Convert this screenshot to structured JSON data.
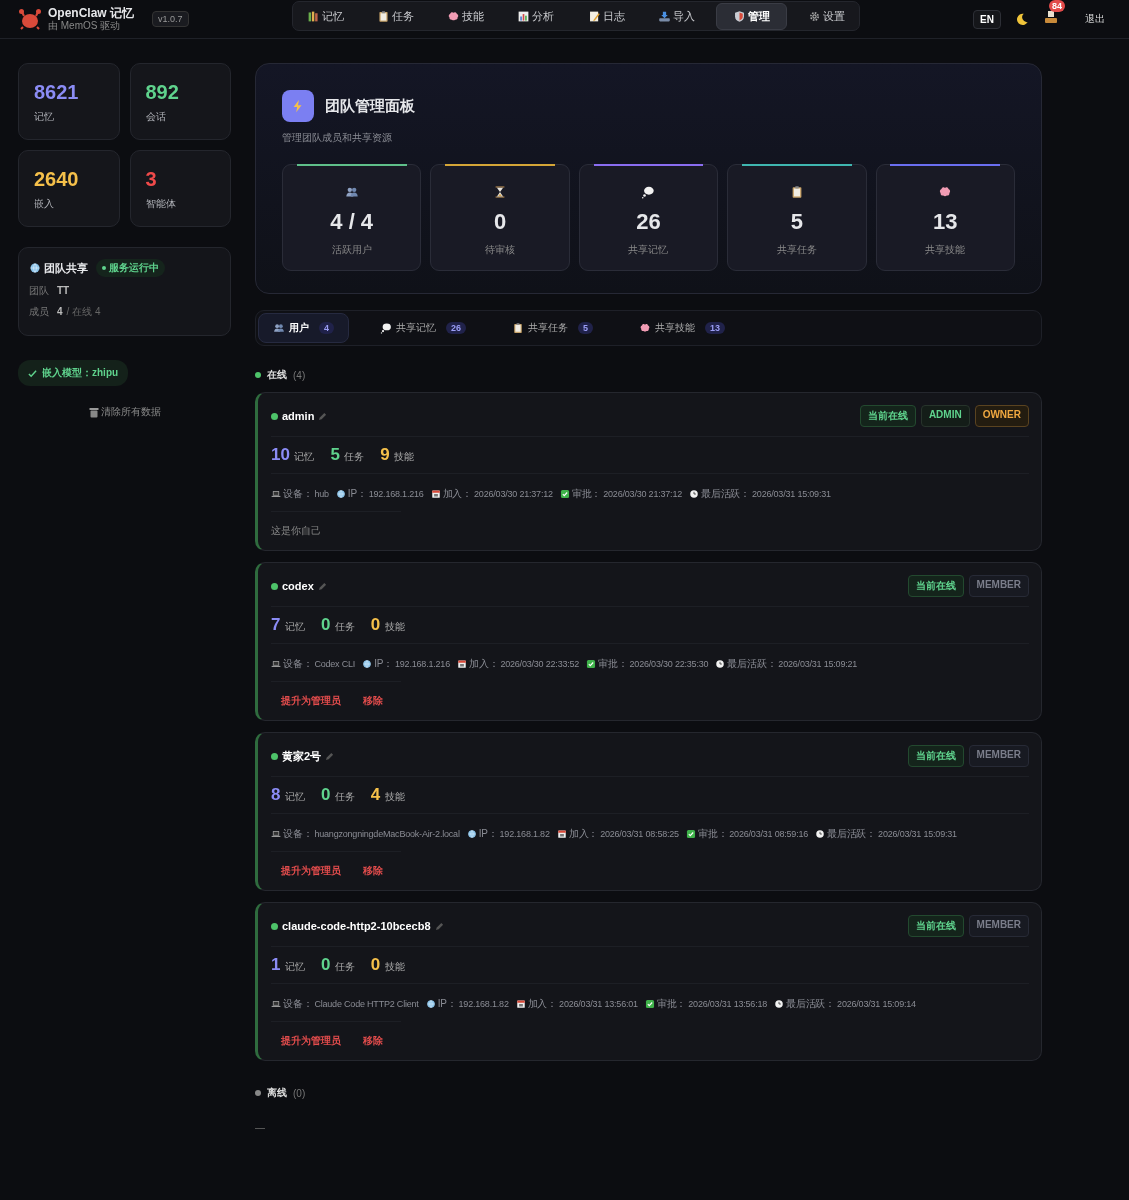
{
  "header": {
    "app_name": "OpenClaw 记忆",
    "subtitle": "由 MemOS 驱动",
    "version": "v1.0.7",
    "nav": [
      {
        "label": "记忆",
        "selected": false
      },
      {
        "label": "任务",
        "selected": false
      },
      {
        "label": "技能",
        "selected": false
      },
      {
        "label": "分析",
        "selected": false
      },
      {
        "label": "日志",
        "selected": false
      },
      {
        "label": "导入",
        "selected": false
      },
      {
        "label": "管理",
        "selected": true
      },
      {
        "label": "设置",
        "selected": false
      }
    ],
    "language": "EN",
    "notification_count": "84",
    "logout": "退出"
  },
  "sidebar": {
    "stats": [
      {
        "value": "8621",
        "label": "记忆",
        "color": "#8b8cf5"
      },
      {
        "value": "892",
        "label": "会话",
        "color": "#5fd38d"
      },
      {
        "value": "2640",
        "label": "嵌入",
        "color": "#f5c04a"
      },
      {
        "value": "3",
        "label": "智能体",
        "color": "#ef4a4a"
      }
    ],
    "team_share": {
      "title": "团队共享",
      "status": "服务运行中",
      "running": true,
      "team_label": "团队",
      "team_value": "TT",
      "members_label": "成员",
      "members_value": "4",
      "members_online": "/ 在线 4"
    },
    "embedding": "嵌入模型：zhipu",
    "clear_data": "清除所有数据"
  },
  "panel": {
    "title": "团队管理面板",
    "subtitle": "管理团队成员和共享资源",
    "stats": [
      {
        "value": "4 / 4",
        "label": "活跃用户",
        "color": "#5fbf8a"
      },
      {
        "value": "0",
        "label": "待审核",
        "color": "#d4a537"
      },
      {
        "value": "26",
        "label": "共享记忆",
        "color": "#8a6df0"
      },
      {
        "value": "5",
        "label": "共享任务",
        "color": "#3fb6b0"
      },
      {
        "value": "13",
        "label": "共享技能",
        "color": "#6a6ef0"
      }
    ]
  },
  "tabs": [
    {
      "label": "用户",
      "count": "4",
      "selected": true
    },
    {
      "label": "共享记忆",
      "count": "26",
      "selected": false
    },
    {
      "label": "共享任务",
      "count": "5",
      "selected": false
    },
    {
      "label": "共享技能",
      "count": "13",
      "selected": false
    }
  ],
  "online_section": {
    "title": "在线",
    "count": "(4)"
  },
  "users": [
    {
      "name": "admin",
      "online": true,
      "badges": [
        {
          "label": "当前在线",
          "kind": "online"
        },
        {
          "label": "ADMIN",
          "kind": "admin"
        },
        {
          "label": "OWNER",
          "kind": "owner"
        }
      ],
      "counts": [
        {
          "amount": "10",
          "unit": "记忆"
        },
        {
          "amount": "5",
          "unit": "任务"
        },
        {
          "amount": "9",
          "unit": "技能"
        }
      ],
      "meta": [
        {
          "label": "设备：",
          "value": "hub"
        },
        {
          "label": "IP：",
          "value": "192.168.1.216"
        },
        {
          "label": "加入：",
          "value": "2026/03/30 21:37:12"
        },
        {
          "label": "审批：",
          "value": "2026/03/30 21:37:12"
        },
        {
          "label": "最后活跃：",
          "value": "2026/03/31 15:09:31"
        }
      ],
      "note": "这是你自己"
    },
    {
      "name": "codex",
      "online": true,
      "badges": [
        {
          "label": "当前在线",
          "kind": "online"
        },
        {
          "label": "MEMBER",
          "kind": "member"
        }
      ],
      "counts": [
        {
          "amount": "7",
          "unit": "记忆"
        },
        {
          "amount": "0",
          "unit": "任务"
        },
        {
          "amount": "0",
          "unit": "技能"
        }
      ],
      "meta": [
        {
          "label": "设备：",
          "value": "Codex CLI"
        },
        {
          "label": "IP：",
          "value": "192.168.1.216"
        },
        {
          "label": "加入：",
          "value": "2026/03/30 22:33:52"
        },
        {
          "label": "审批：",
          "value": "2026/03/30 22:35:30"
        },
        {
          "label": "最后活跃：",
          "value": "2026/03/31 15:09:21"
        }
      ],
      "actions": [
        "提升为管理员",
        "移除"
      ]
    },
    {
      "name": "黄家2号",
      "online": true,
      "badges": [
        {
          "label": "当前在线",
          "kind": "online"
        },
        {
          "label": "MEMBER",
          "kind": "member"
        }
      ],
      "counts": [
        {
          "amount": "8",
          "unit": "记忆"
        },
        {
          "amount": "0",
          "unit": "任务"
        },
        {
          "amount": "4",
          "unit": "技能"
        }
      ],
      "meta": [
        {
          "label": "设备：",
          "value": "huangzongningdeMacBook-Air-2.local"
        },
        {
          "label": "IP：",
          "value": "192.168.1.82"
        },
        {
          "label": "加入：",
          "value": "2026/03/31 08:58:25"
        },
        {
          "label": "审批：",
          "value": "2026/03/31 08:59:16"
        },
        {
          "label": "最后活跃：",
          "value": "2026/03/31 15:09:31"
        }
      ],
      "actions": [
        "提升为管理员",
        "移除"
      ]
    },
    {
      "name": "claude-code-http2-10bcecb8",
      "online": true,
      "badges": [
        {
          "label": "当前在线",
          "kind": "online"
        },
        {
          "label": "MEMBER",
          "kind": "member"
        }
      ],
      "counts": [
        {
          "amount": "1",
          "unit": "记忆"
        },
        {
          "amount": "0",
          "unit": "任务"
        },
        {
          "amount": "0",
          "unit": "技能"
        }
      ],
      "meta": [
        {
          "label": "设备：",
          "value": "Claude Code HTTP2 Client"
        },
        {
          "label": "IP：",
          "value": "192.168.1.82"
        },
        {
          "label": "加入：",
          "value": "2026/03/31 13:56:01"
        },
        {
          "label": "审批：",
          "value": "2026/03/31 13:56:18"
        },
        {
          "label": "最后活跃：",
          "value": "2026/03/31 15:09:14"
        }
      ],
      "actions": [
        "提升为管理员",
        "移除"
      ]
    }
  ],
  "offline_section": {
    "title": "离线",
    "count": "(0)"
  }
}
